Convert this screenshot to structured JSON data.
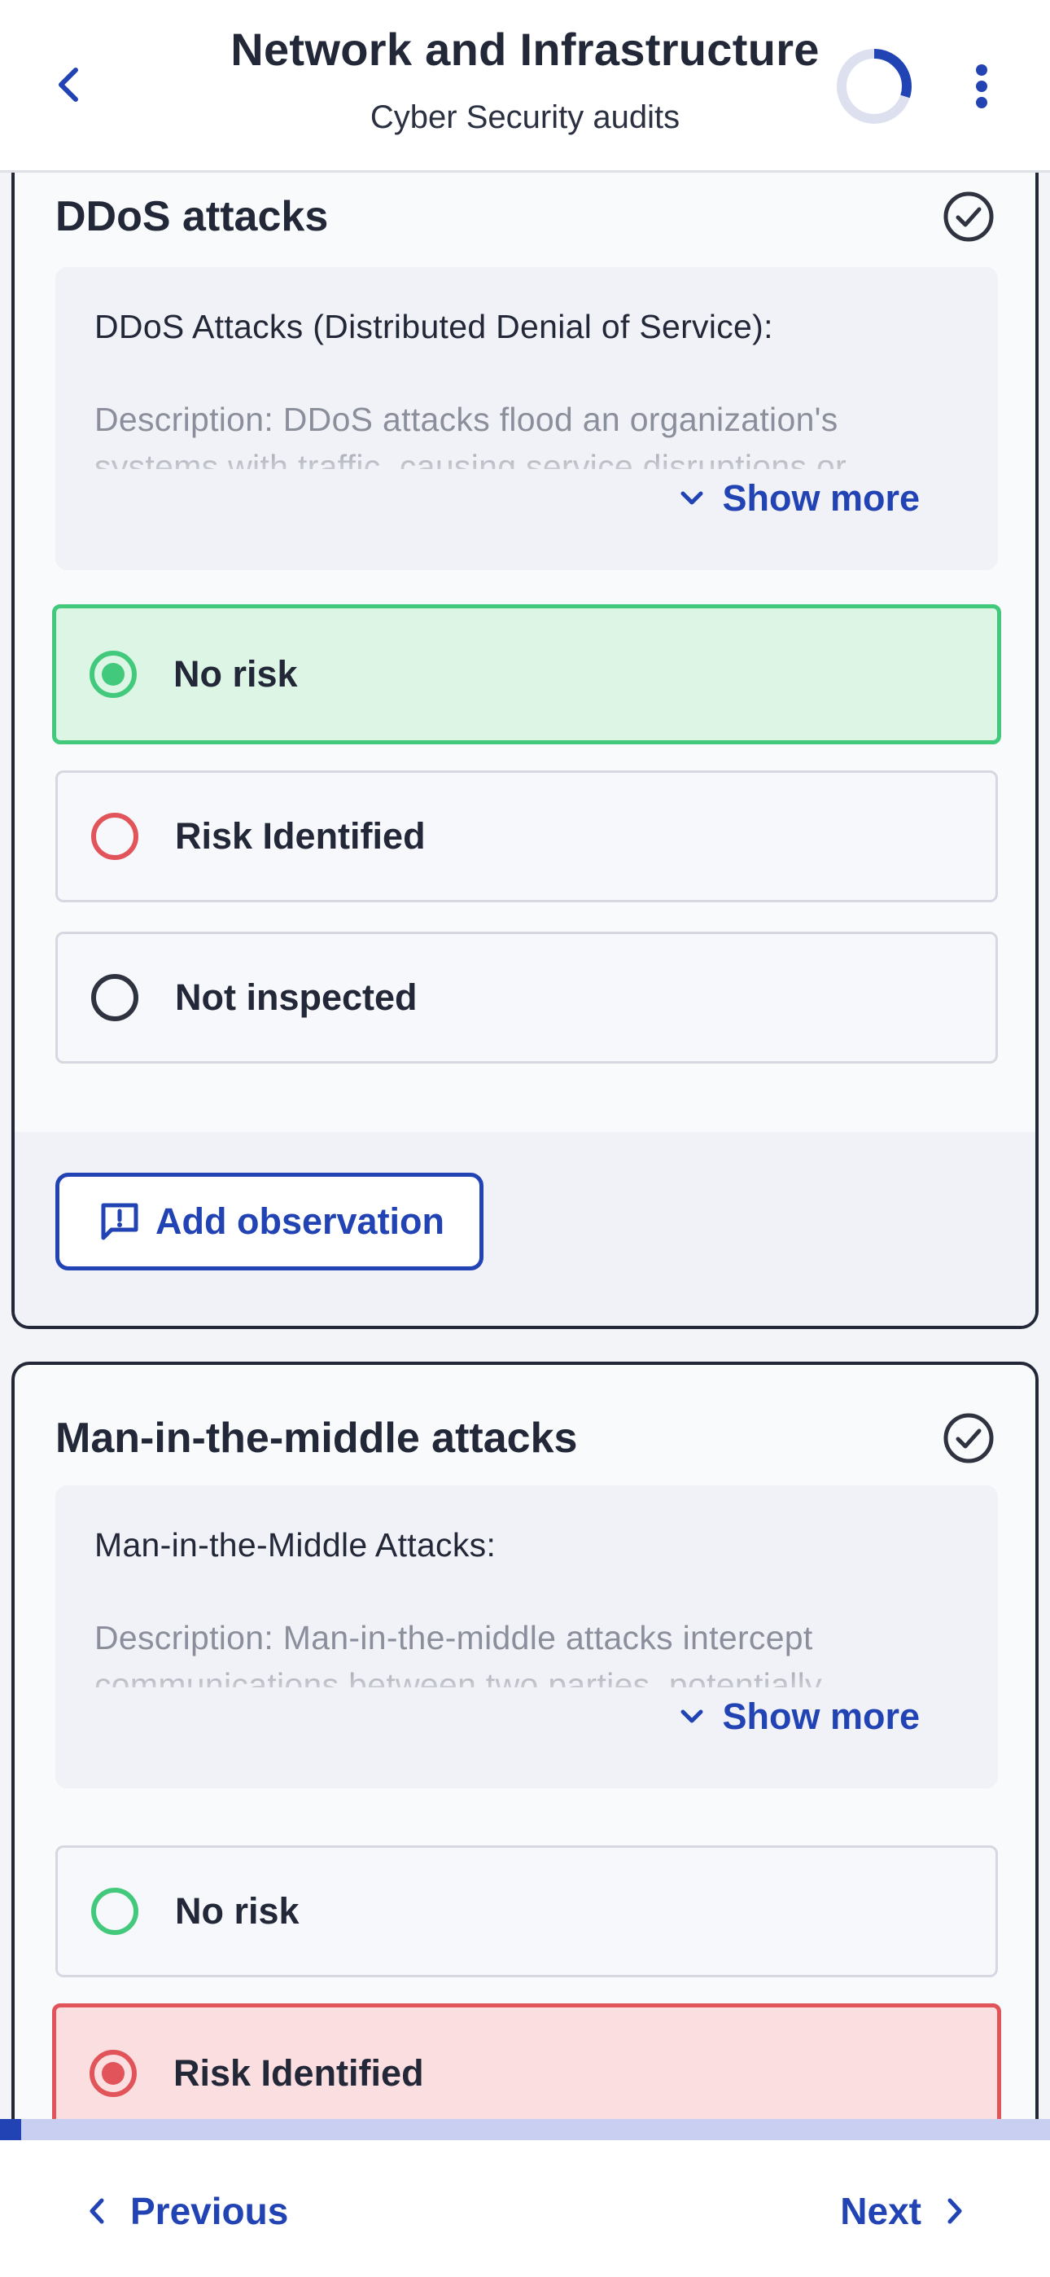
{
  "header": {
    "title": "Network and Infrastructure",
    "subtitle": "Cyber Security audits",
    "progress_fraction": 0.3,
    "colors": {
      "accent": "#2243b3",
      "ring_track": "#dde1ef"
    }
  },
  "sections": [
    {
      "title": "DDoS attacks",
      "status_icon": "check-circle-icon",
      "description_title": "DDoS Attacks (Distributed Denial of Service):",
      "description_text": "Description: DDoS attacks flood an organization's systems with traffic, causing service disruptions or",
      "show_more_label": "Show more",
      "options": [
        {
          "label": "No risk",
          "color": "#43c97b",
          "selected": true
        },
        {
          "label": "Risk Identified",
          "color": "#e0545a",
          "selected": false
        },
        {
          "label": "Not inspected",
          "color": "#2f3340",
          "selected": false
        }
      ],
      "add_observation_label": "Add observation"
    },
    {
      "title": "Man-in-the-middle attacks",
      "status_icon": "check-circle-icon",
      "description_title": "Man-in-the-Middle Attacks:",
      "description_text": "Description: Man-in-the-middle attacks intercept communications between two parties, potentially",
      "show_more_label": "Show more",
      "options": [
        {
          "label": "No risk",
          "color": "#43c97b",
          "selected": false
        },
        {
          "label": "Risk Identified",
          "color": "#e0545a",
          "selected": true
        }
      ]
    }
  ],
  "page_progress_fraction": 0.02,
  "footer": {
    "previous_label": "Previous",
    "next_label": "Next"
  }
}
